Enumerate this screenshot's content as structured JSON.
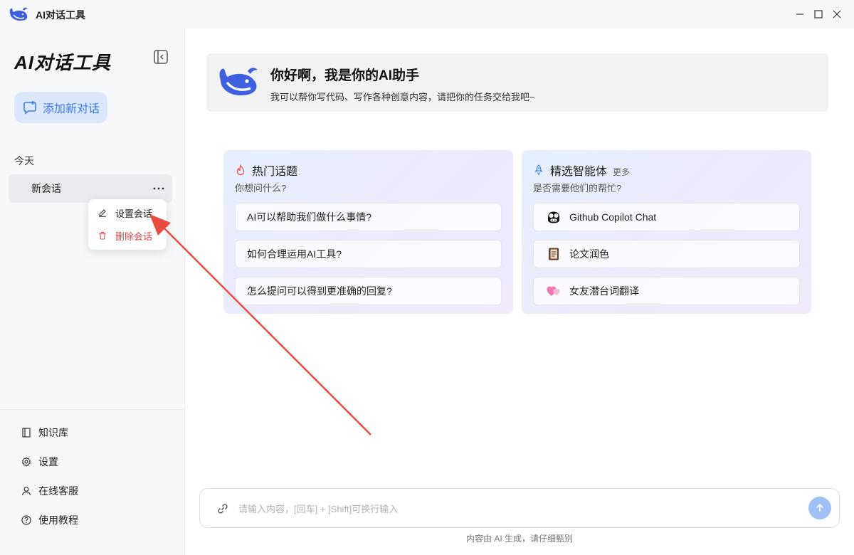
{
  "window": {
    "app_name": "AI对话工具"
  },
  "sidebar": {
    "title": "AI对话工具",
    "new_chat_label": "添加新对话",
    "group_label": "今天",
    "conversations": [
      {
        "label": "新会话"
      }
    ],
    "links": [
      {
        "label": "知识库",
        "icon": "book-icon"
      },
      {
        "label": "设置",
        "icon": "gear-icon"
      },
      {
        "label": "在线客服",
        "icon": "user-icon"
      },
      {
        "label": "使用教程",
        "icon": "help-icon"
      }
    ]
  },
  "context_menu": {
    "items": [
      {
        "label": "设置会话",
        "icon": "edit-icon",
        "color": "#222222"
      },
      {
        "label": "删除会话",
        "icon": "trash-icon",
        "color": "#e5484d"
      }
    ]
  },
  "welcome": {
    "title": "你好啊，我是你的AI助手",
    "subtitle": "我可以帮你写代码、写作各种创意内容，请把你的任务交给我吧~"
  },
  "hot_topics": {
    "title": "热门话题",
    "subtitle": "你想问什么?",
    "items": [
      {
        "label": "AI可以帮助我们做什么事情?"
      },
      {
        "label": "如何合理运用AI工具?"
      },
      {
        "label": "怎么提问可以得到更准确的回复?"
      }
    ]
  },
  "agents": {
    "title": "精选智能体",
    "more_label": "更多",
    "subtitle": "是否需要他们的帮忙?",
    "items": [
      {
        "label": "Github Copilot Chat",
        "icon": "copilot-icon"
      },
      {
        "label": "论文润色",
        "icon": "notebook-icon"
      },
      {
        "label": "女友潜台词翻译",
        "icon": "hearts-icon"
      }
    ]
  },
  "input": {
    "placeholder": "请输入内容，[回车] + [Shift]可换行输入"
  },
  "footer": {
    "disclaimer": "内容由 AI 生成，请仔细甄别"
  },
  "colors": {
    "accent": "#3d7bf7",
    "danger": "#e5484d",
    "send_button": "#9ec0f7",
    "annotation_arrow": "#e84c3d"
  }
}
